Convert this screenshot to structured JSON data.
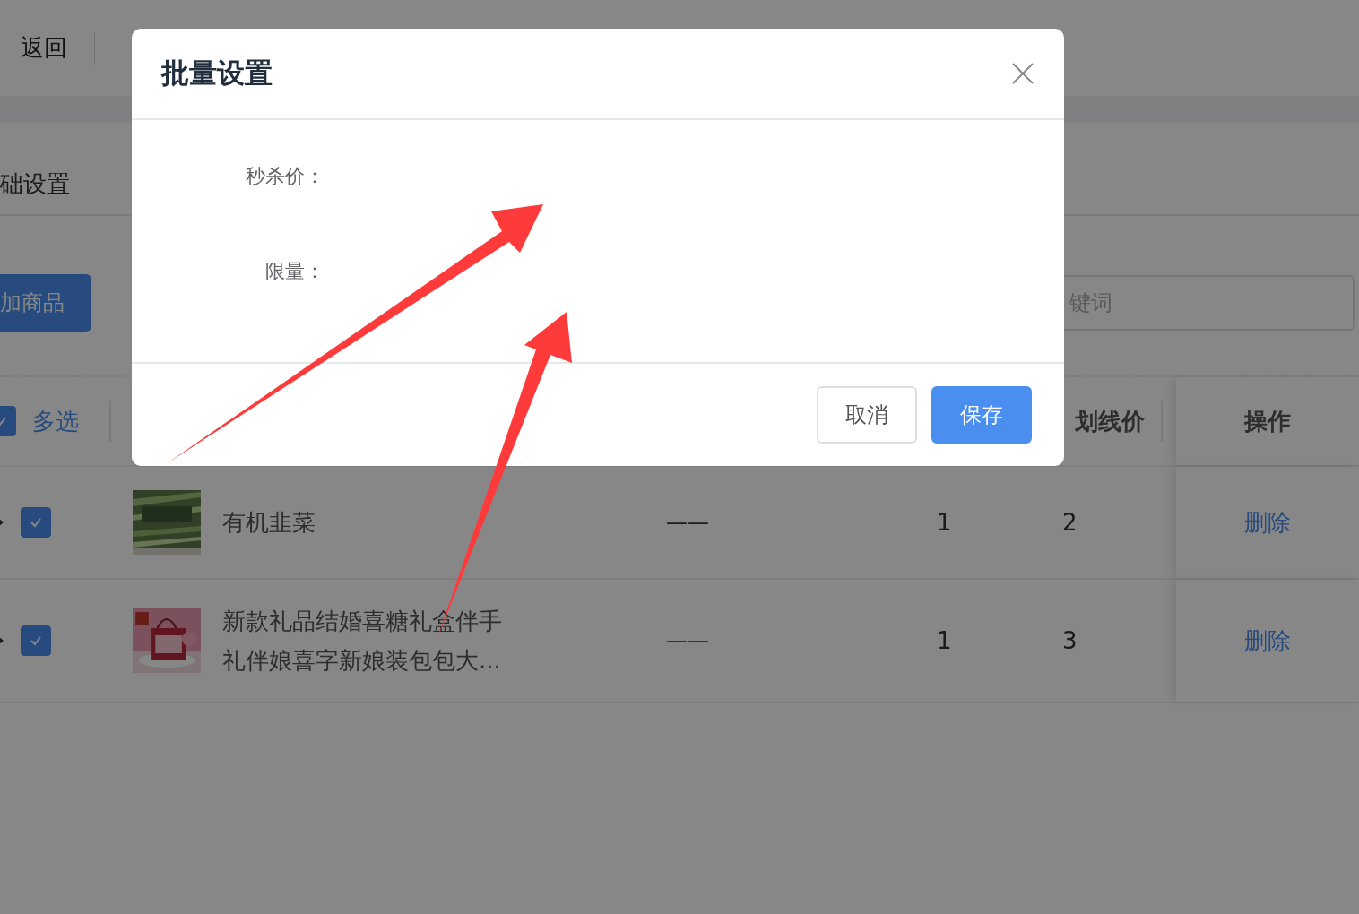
{
  "header": {
    "back": "返回"
  },
  "section_tab": {
    "label": "础设置"
  },
  "toolbar": {
    "add_button": "加商品",
    "search": {
      "placeholder": "键词"
    }
  },
  "table": {
    "select_all": {
      "label": "多选",
      "checked": true
    },
    "columns": [
      {
        "label": "划线价"
      },
      {
        "label": "操作"
      }
    ],
    "rows": [
      {
        "checked": true,
        "name": "有机韭菜",
        "column_3": "——",
        "column_4": "1",
        "strike_price": "2",
        "action": "删除"
      },
      {
        "checked": true,
        "name": "新款礼品结婚喜糖礼盒伴手礼伴娘喜字新娘装包包大...",
        "column_3": "——",
        "column_4": "1",
        "strike_price": "3",
        "action": "删除"
      }
    ]
  },
  "dialog": {
    "title": "批量设置",
    "fields": [
      {
        "label": "秒杀价："
      },
      {
        "label": "限量："
      }
    ],
    "buttons": [
      {
        "label": "取消",
        "kind": "default"
      },
      {
        "label": "保存",
        "kind": "primary"
      }
    ]
  }
}
